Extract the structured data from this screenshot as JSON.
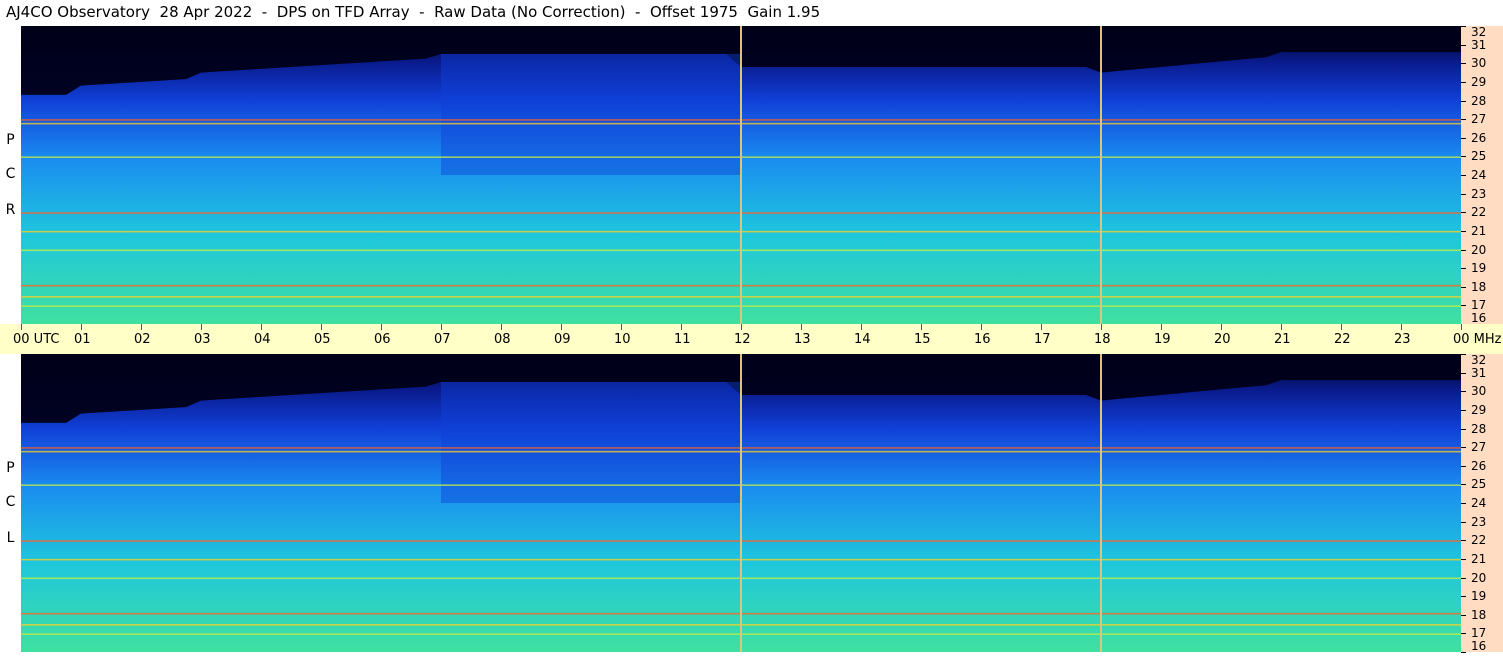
{
  "header": {
    "title": "AJ4CO Observatory  28 Apr 2022  -  DPS on TFD Array  -  Raw Data (No Correction)  -  Offset 1975  Gain 1.95"
  },
  "chart_data": {
    "type": "heatmap",
    "title": "AJ4CO Observatory  28 Apr 2022  -  DPS on TFD Array  -  Raw Data (No Correction)  -  Offset 1975  Gain 1.95",
    "x": {
      "unit": "UTC",
      "range": [
        0,
        24
      ],
      "tick_labels": [
        "00",
        "01",
        "02",
        "03",
        "04",
        "05",
        "06",
        "07",
        "08",
        "09",
        "10",
        "11",
        "12",
        "13",
        "14",
        "15",
        "16",
        "17",
        "18",
        "19",
        "20",
        "21",
        "22",
        "23",
        "00"
      ],
      "start_suffix": "UTC",
      "end_suffix": "MHz"
    },
    "y": {
      "unit": "MHz",
      "range": [
        16,
        32
      ],
      "tick_labels": [
        "32",
        "31",
        "30",
        "29",
        "28",
        "27",
        "26",
        "25",
        "24",
        "23",
        "22",
        "21",
        "20",
        "19",
        "18",
        "17",
        "16"
      ]
    },
    "panels": [
      {
        "name": "R C P",
        "side_label": [
          "R",
          "C",
          "P"
        ]
      },
      {
        "name": "L C P",
        "side_label": [
          "L",
          "C",
          "P"
        ]
      }
    ],
    "time_markers_utc": [
      12,
      18
    ],
    "interference_lines_mhz": [
      27.0,
      26.8,
      25.0,
      22.0,
      21.0,
      20.0,
      18.1,
      17.5,
      17.0
    ],
    "colormap": [
      "#000018",
      "#0a1a8c",
      "#1040d8",
      "#1a8ef0",
      "#1ec6dc",
      "#40e0a0",
      "#c8f040",
      "#ffd020",
      "#ff6020",
      "#e020c0"
    ],
    "grid": false
  }
}
